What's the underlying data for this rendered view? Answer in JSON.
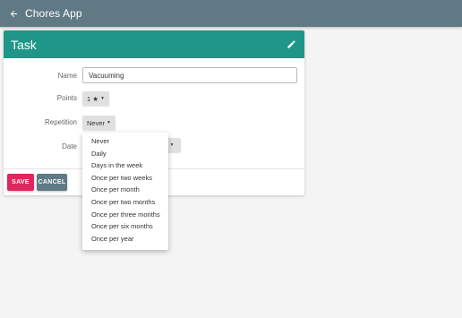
{
  "app": {
    "title": "Chores App"
  },
  "card": {
    "title": "Task"
  },
  "form": {
    "name_label": "Name",
    "name_value": "Vacuuming",
    "points_label": "Points",
    "points_value": "1 ★",
    "repetition_label": "Repetition",
    "repetition_value": "Never",
    "date_label": "Date"
  },
  "actions": {
    "save_label": "SAVE",
    "cancel_label": "CANCEL"
  },
  "repetition_options": [
    "Never",
    "Daily",
    "Days in the week",
    "Once per two weeks",
    "Once per month",
    "Once per two months",
    "Once per three months",
    "Once per six months",
    "Once per year"
  ],
  "colors": {
    "appbar": "#5f7a85",
    "card_header": "#1e9688",
    "save": "#e0255f",
    "cancel": "#5f7a85"
  },
  "icons": {
    "back": "arrow-left-icon",
    "edit": "pencil-icon",
    "caret": "caret-down-icon"
  }
}
